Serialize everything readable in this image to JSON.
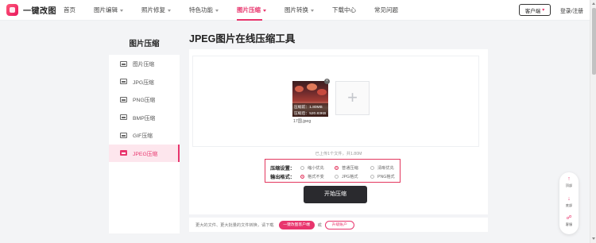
{
  "brand": {
    "name": "一键改图"
  },
  "nav": {
    "items": [
      {
        "label": "首页",
        "dropdown": false,
        "active": false
      },
      {
        "label": "图片编辑",
        "dropdown": true,
        "active": false
      },
      {
        "label": "照片修复",
        "dropdown": true,
        "active": false
      },
      {
        "label": "特色功能",
        "dropdown": true,
        "active": false
      },
      {
        "label": "图片压缩",
        "dropdown": true,
        "active": true
      },
      {
        "label": "图片转换",
        "dropdown": true,
        "active": false
      },
      {
        "label": "下载中心",
        "dropdown": false,
        "active": false
      },
      {
        "label": "常见问题",
        "dropdown": false,
        "active": false
      }
    ],
    "client_button": "客户端",
    "login": "登录/注册"
  },
  "sidebar": {
    "title": "图片压缩",
    "items": [
      {
        "label": "图片压缩",
        "active": false
      },
      {
        "label": "JPG压缩",
        "active": false
      },
      {
        "label": "PNG压缩",
        "active": false
      },
      {
        "label": "BMP压缩",
        "active": false
      },
      {
        "label": "GIF压缩",
        "active": false
      },
      {
        "label": "JPEG压缩",
        "active": true
      }
    ]
  },
  "main": {
    "title": "JPEG图片在线压缩工具",
    "file": {
      "original_size": "压缩前：1.80MB",
      "compressed_size": "压缩后：520.83KB",
      "name": "17国.jpeg"
    },
    "upload_stats": "已上传1个文件，共1.80M",
    "settings": {
      "compression_label": "压缩设置：",
      "compression_options": [
        {
          "label": "缩小优先",
          "selected": false
        },
        {
          "label": "普通压缩",
          "selected": true
        },
        {
          "label": "清晰优先",
          "selected": false
        }
      ],
      "format_label": "输出格式：",
      "format_options": [
        {
          "label": "格式不变",
          "selected": true
        },
        {
          "label": "JPG格式",
          "selected": false
        },
        {
          "label": "PNG格式",
          "selected": false
        }
      ]
    },
    "start_button": "开始压缩",
    "bottom": {
      "text": "更大的文件、更大批量的文件转换，请下载",
      "download_button": "一键改图客户端",
      "or": "或",
      "vip_button": "升级账户"
    }
  },
  "float_tools": [
    {
      "icon": "arrow-up-icon",
      "label": "顶部"
    },
    {
      "icon": "arrow-down-icon",
      "label": "底部"
    },
    {
      "icon": "headset-icon",
      "label": "客服"
    }
  ],
  "colors": {
    "accent": "#e8356d",
    "dark_button": "#2a2a2e"
  }
}
